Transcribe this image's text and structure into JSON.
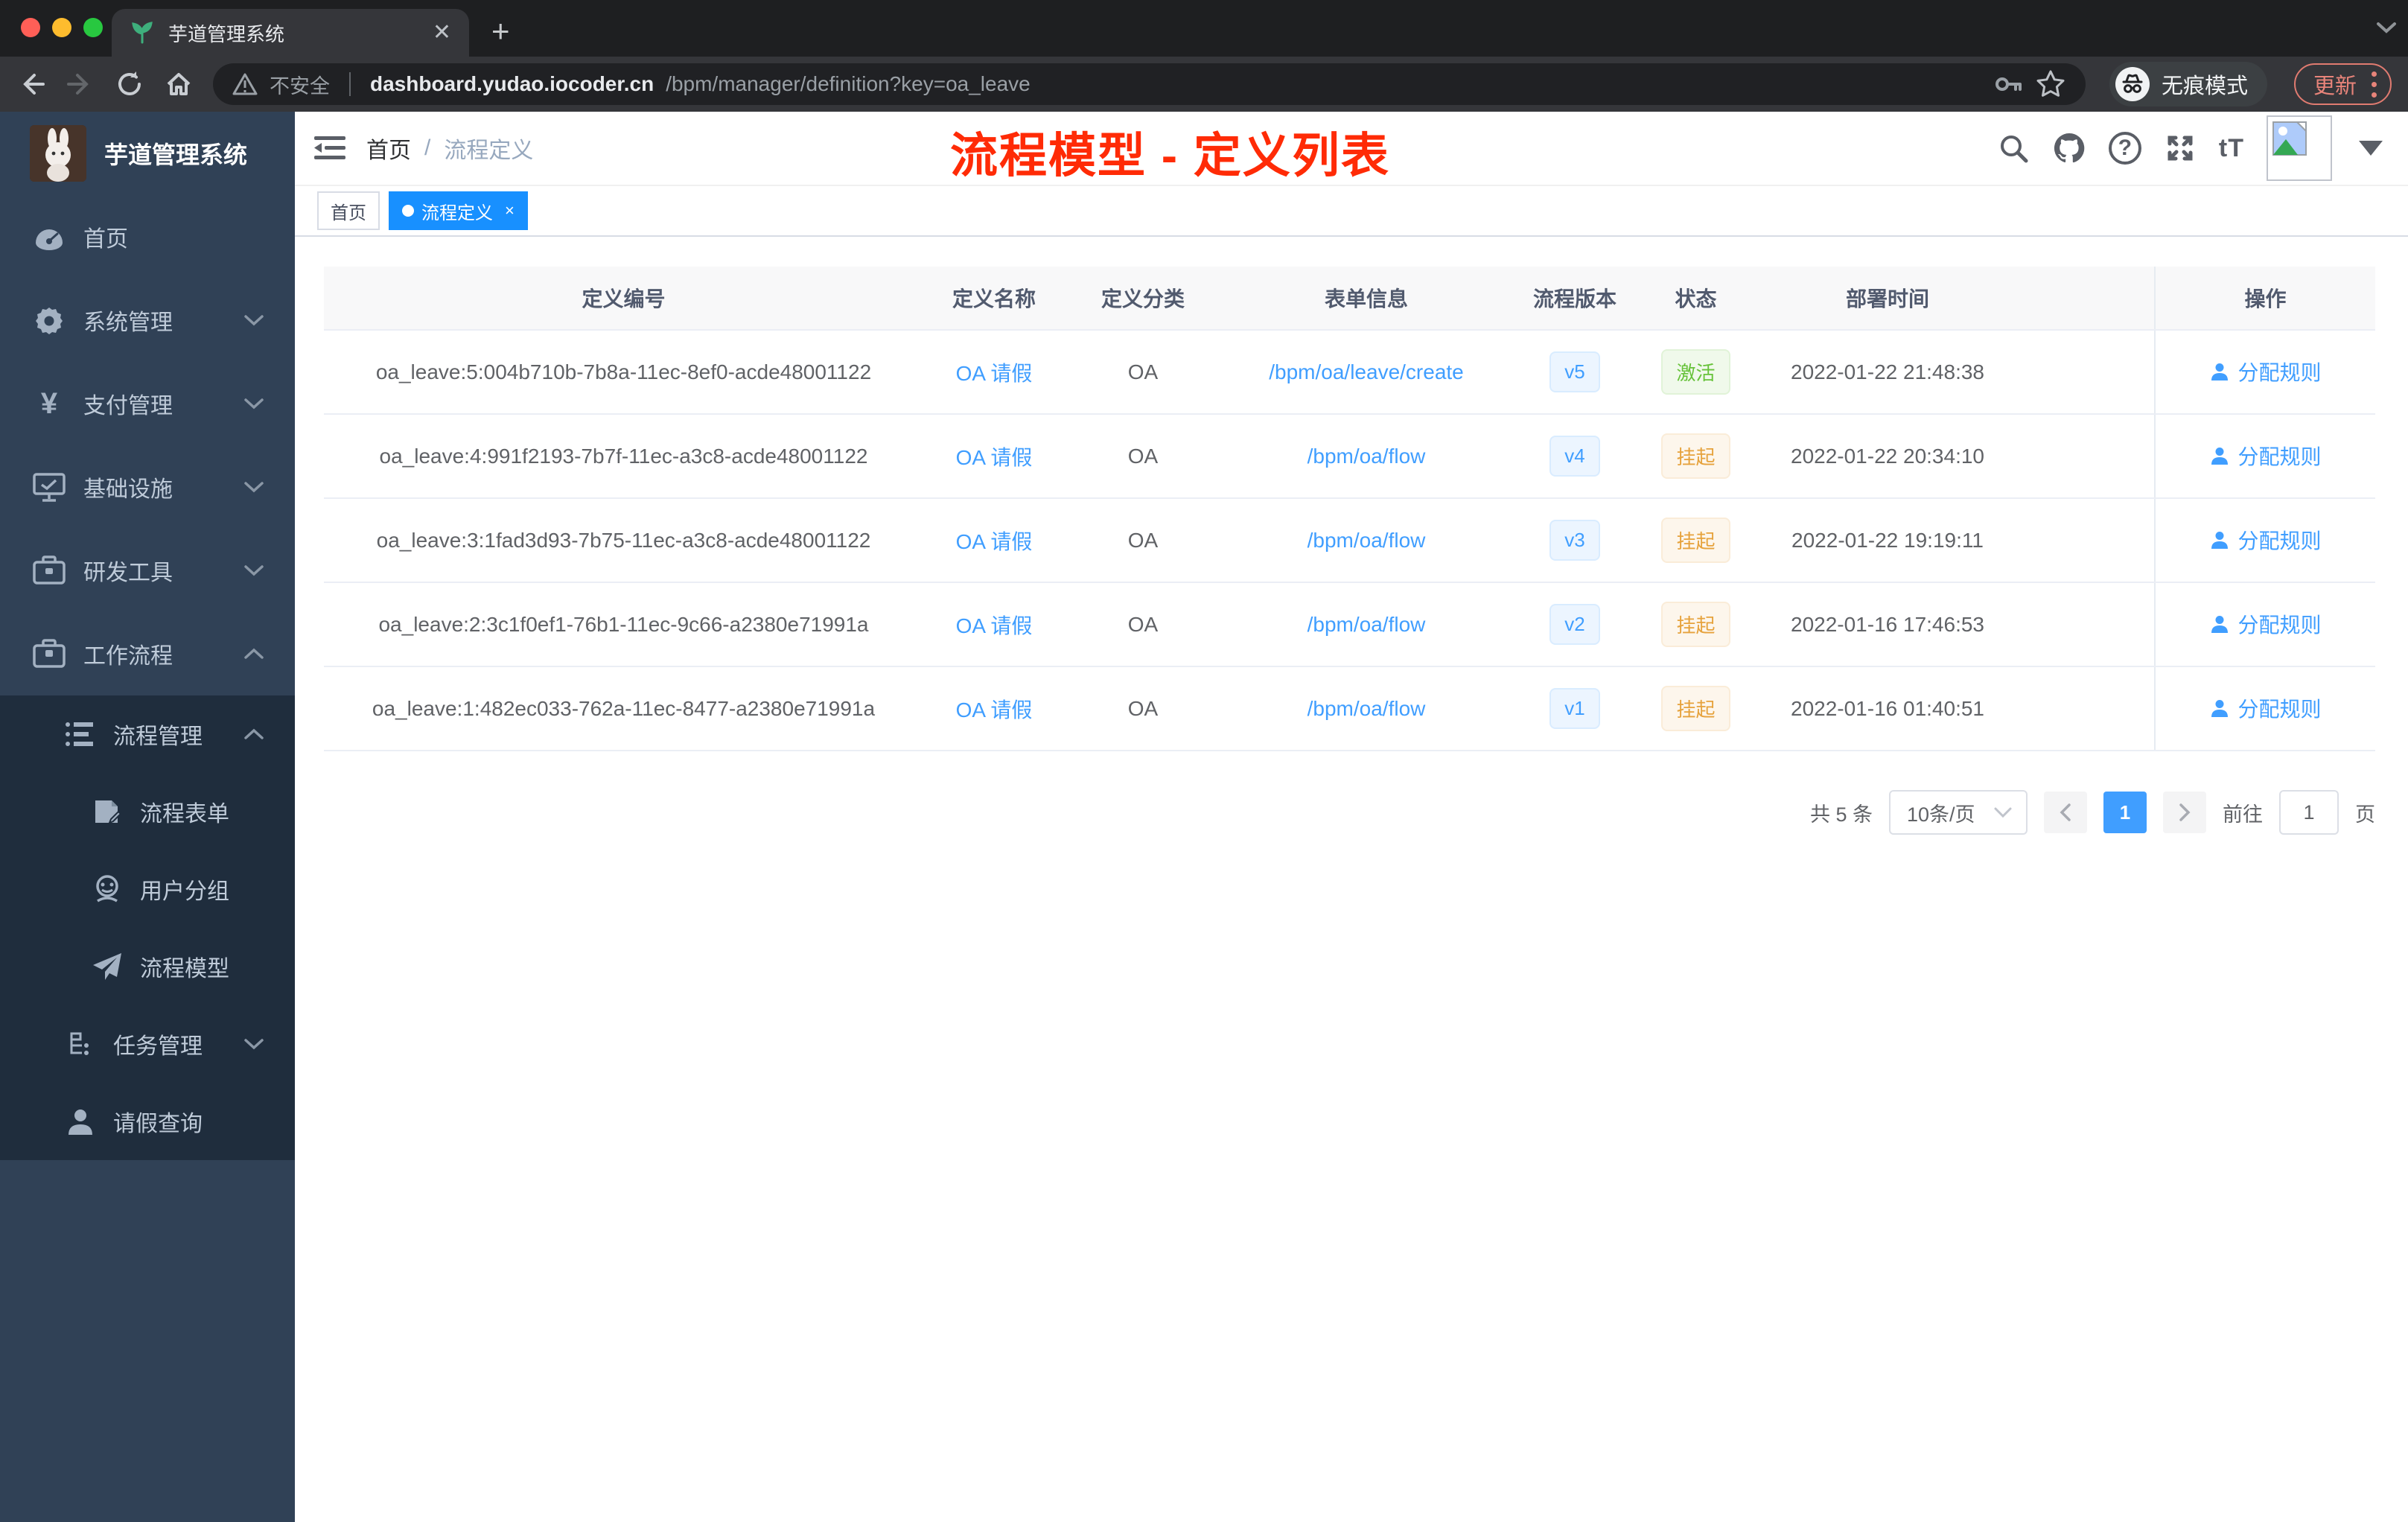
{
  "browser": {
    "tab_title": "芋道管理系统",
    "security_label": "不安全",
    "url_host": "dashboard.yudao.iocoder.cn",
    "url_path": "/bpm/manager/definition?key=oa_leave",
    "incognito_label": "无痕模式",
    "update_label": "更新"
  },
  "annotation": {
    "text": "流程模型 - 定义列表",
    "color": "#ff2b06"
  },
  "sidebar": {
    "logo_title": "芋道管理系统",
    "items": [
      {
        "label": "首页"
      },
      {
        "label": "系统管理"
      },
      {
        "label": "支付管理"
      },
      {
        "label": "基础设施"
      },
      {
        "label": "研发工具"
      },
      {
        "label": "工作流程"
      }
    ],
    "submenu": {
      "parent": "流程管理",
      "children": [
        "流程表单",
        "用户分组",
        "流程模型"
      ],
      "tasks_label": "任务管理",
      "leave_label": "请假查询"
    }
  },
  "breadcrumb": {
    "home": "首页",
    "separator": "/",
    "current": "流程定义"
  },
  "tags": {
    "home": "首页",
    "active": "流程定义",
    "close": "×"
  },
  "icons": {
    "font_size_glyph": "tT",
    "help_glyph": "?"
  },
  "table": {
    "columns": [
      "定义编号",
      "定义名称",
      "定义分类",
      "表单信息",
      "流程版本",
      "状态",
      "部署时间",
      "操作"
    ],
    "action_label": "分配规则",
    "rows": [
      {
        "id": "oa_leave:5:004b710b-7b8a-11ec-8ef0-acde48001122",
        "name": "OA 请假",
        "category": "OA",
        "form": "/bpm/oa/leave/create",
        "version": "v5",
        "status": "激活",
        "deployed": "2022-01-22 21:48:38"
      },
      {
        "id": "oa_leave:4:991f2193-7b7f-11ec-a3c8-acde48001122",
        "name": "OA 请假",
        "category": "OA",
        "form": "/bpm/oa/flow",
        "version": "v4",
        "status": "挂起",
        "deployed": "2022-01-22 20:34:10"
      },
      {
        "id": "oa_leave:3:1fad3d93-7b75-11ec-a3c8-acde48001122",
        "name": "OA 请假",
        "category": "OA",
        "form": "/bpm/oa/flow",
        "version": "v3",
        "status": "挂起",
        "deployed": "2022-01-22 19:19:11"
      },
      {
        "id": "oa_leave:2:3c1f0ef1-76b1-11ec-9c66-a2380e71991a",
        "name": "OA 请假",
        "category": "OA",
        "form": "/bpm/oa/flow",
        "version": "v2",
        "status": "挂起",
        "deployed": "2022-01-16 17:46:53"
      },
      {
        "id": "oa_leave:1:482ec033-762a-11ec-8477-a2380e71991a",
        "name": "OA 请假",
        "category": "OA",
        "form": "/bpm/oa/flow",
        "version": "v1",
        "status": "挂起",
        "deployed": "2022-01-16 01:40:51"
      }
    ]
  },
  "pagination": {
    "total": "共 5 条",
    "page_size": "10条/页",
    "current": "1",
    "goto_label": "前往",
    "goto_value": "1",
    "page_unit": "页"
  },
  "colors": {
    "accent": "#409eff",
    "tag_active": "#1890ff",
    "status_active": "#67c23a",
    "status_suspended": "#e6a23c"
  }
}
